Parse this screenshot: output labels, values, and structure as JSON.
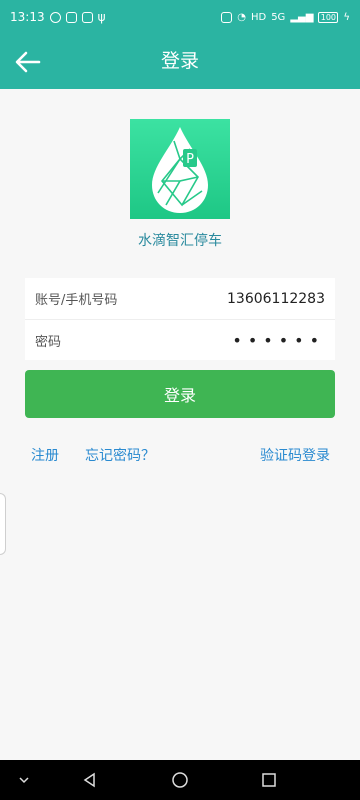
{
  "status_bar": {
    "time": "13:13",
    "network_label": "HD",
    "signal_label": "5G",
    "battery_level": "100"
  },
  "header": {
    "title": "登录"
  },
  "app": {
    "name": "水滴智汇停车"
  },
  "form": {
    "account_label": "账号/手机号码",
    "account_value": "13606112283",
    "password_label": "密码",
    "password_value": "••••••"
  },
  "actions": {
    "login_label": "登录",
    "register_label": "注册",
    "forgot_label": "忘记密码？",
    "sms_login_label": "验证码登录"
  },
  "colors": {
    "header_bg": "#2bb4a2",
    "button_bg": "#3fb553",
    "link": "#2a8ad0",
    "app_name": "#2a8a9e"
  },
  "icons": {
    "back": "arrow-left-icon",
    "logo": "water-drop-logo",
    "nav_back": "triangle-back-icon",
    "nav_home": "circle-home-icon",
    "nav_recent": "square-recent-icon"
  }
}
